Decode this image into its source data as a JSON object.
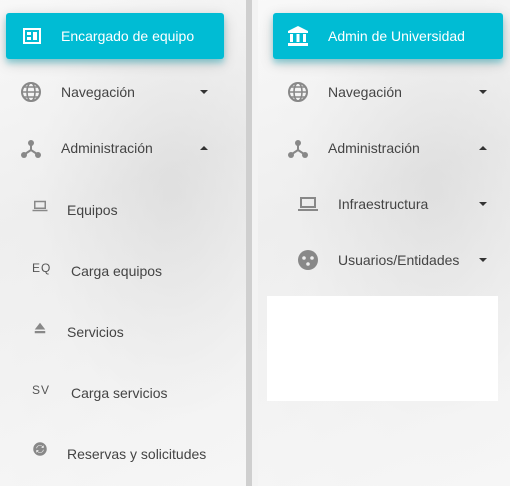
{
  "left": {
    "header": {
      "label": "Encargado de equipo",
      "icon": "dashboard-icon"
    },
    "items": [
      {
        "label": "Navegación",
        "icon": "globe-icon",
        "state": "collapsed"
      },
      {
        "label": "Administración",
        "icon": "hub-icon",
        "state": "expanded"
      }
    ],
    "subitems": [
      {
        "label": "Equipos",
        "icon": "laptop-icon"
      },
      {
        "label": "Carga equipos",
        "abbr": "EQ"
      },
      {
        "label": "Servicios",
        "icon": "eject-icon"
      },
      {
        "label": "Carga servicios",
        "abbr": "SV"
      },
      {
        "label": "Reservas y solicitudes",
        "icon": "sync-icon"
      }
    ]
  },
  "right": {
    "header": {
      "label": "Admin de Universidad",
      "icon": "bank-icon"
    },
    "items": [
      {
        "label": "Navegación",
        "icon": "globe-icon",
        "state": "collapsed"
      },
      {
        "label": "Administración",
        "icon": "hub-icon",
        "state": "expanded"
      }
    ],
    "subitems": [
      {
        "label": "Infraestructura",
        "icon": "laptop-icon",
        "state": "collapsed"
      },
      {
        "label": "Usuarios/Entidades",
        "icon": "sports-ball-icon",
        "state": "collapsed"
      }
    ]
  },
  "colors": {
    "accent": "#00bcd4",
    "text": "#444444",
    "icon": "#888888"
  }
}
